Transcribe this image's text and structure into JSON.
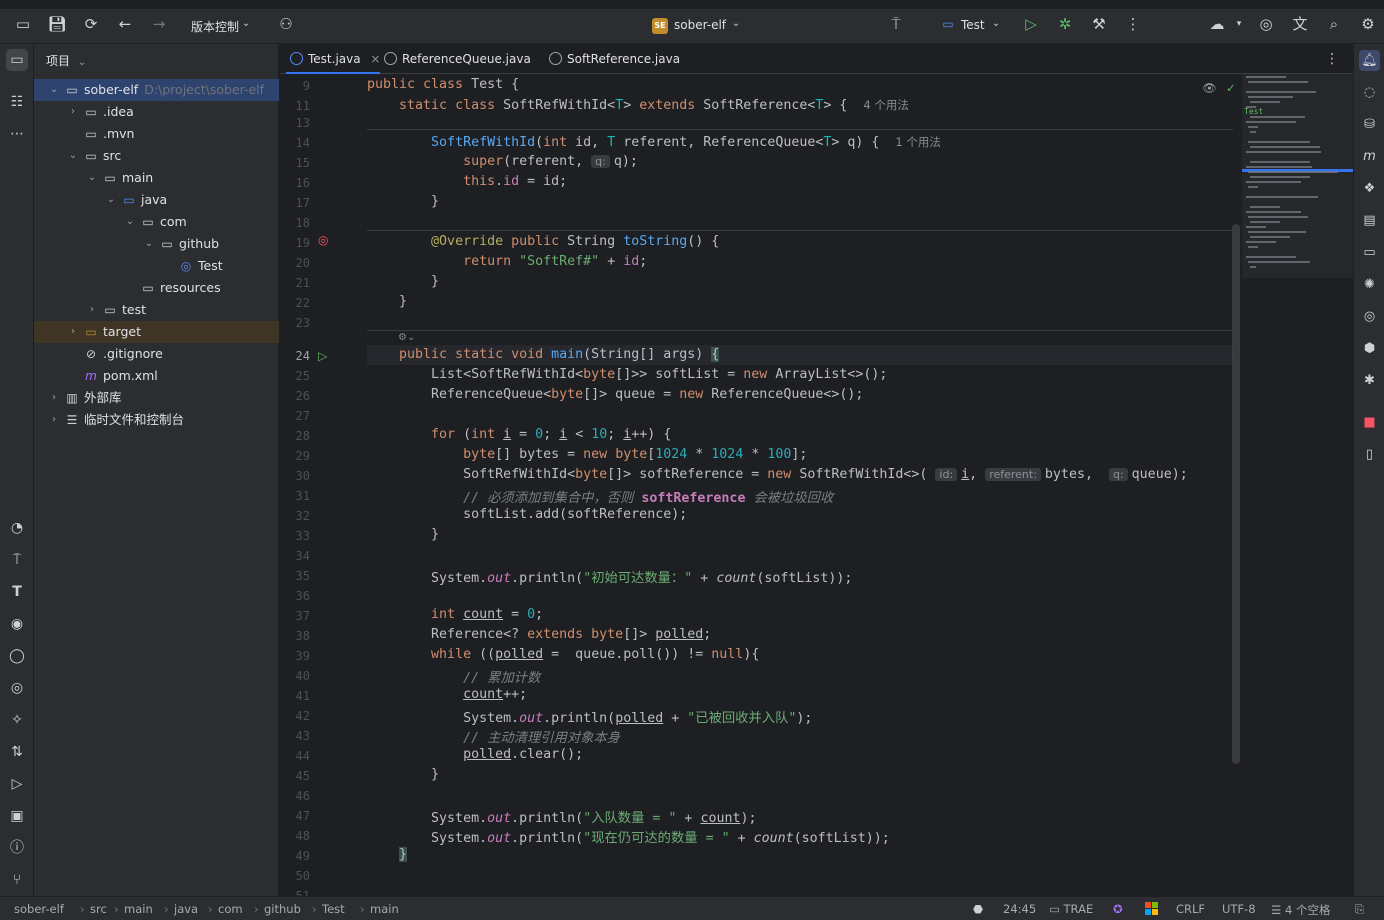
{
  "titlebar": {
    "vcs_label": "版本控制",
    "project_badge": "SE",
    "project_name": "sober-elf",
    "run_config": "Test"
  },
  "project_panel": {
    "header": "项目",
    "tree": [
      {
        "label": "sober-elf",
        "sub": "D:\\project\\sober-elf",
        "icon": "module-folder-icon",
        "indent": 0,
        "arrow": "⌄"
      },
      {
        "label": ".idea",
        "icon": "folder-icon",
        "indent": 1,
        "arrow": "›"
      },
      {
        "label": ".mvn",
        "icon": "folder-icon",
        "indent": 1,
        "arrow": ""
      },
      {
        "label": "src",
        "icon": "folder-icon",
        "indent": 1,
        "arrow": "⌄"
      },
      {
        "label": "main",
        "icon": "folder-icon",
        "indent": 2,
        "arrow": "⌄"
      },
      {
        "label": "java",
        "icon": "source-folder-icon",
        "indent": 3,
        "arrow": "⌄"
      },
      {
        "label": "com",
        "icon": "package-icon",
        "indent": 4,
        "arrow": "⌄"
      },
      {
        "label": "github",
        "icon": "package-icon",
        "indent": 5,
        "arrow": "⌄"
      },
      {
        "label": "Test",
        "icon": "java-class-icon",
        "indent": 6,
        "arrow": ""
      },
      {
        "label": "resources",
        "icon": "resources-folder-icon",
        "indent": 4,
        "arrow": ""
      },
      {
        "label": "test",
        "icon": "folder-icon",
        "indent": 2,
        "arrow": "›"
      },
      {
        "label": "target",
        "icon": "excluded-folder-icon",
        "indent": 1,
        "arrow": "›"
      },
      {
        "label": ".gitignore",
        "icon": "ignore-file-icon",
        "indent": 1,
        "arrow": ""
      },
      {
        "label": "pom.xml",
        "icon": "maven-icon",
        "indent": 1,
        "arrow": ""
      },
      {
        "label": "外部库",
        "icon": "library-icon",
        "indent": 0,
        "arrow": "›"
      },
      {
        "label": "临时文件和控制台",
        "icon": "scratches-icon",
        "indent": 0,
        "arrow": "›"
      }
    ]
  },
  "tabs": [
    {
      "label": "Test.java",
      "close": "×"
    },
    {
      "label": "ReferenceQueue.java",
      "close": ""
    },
    {
      "label": "SoftReference.java",
      "close": ""
    }
  ],
  "editor": {
    "line_numbers": [
      "9",
      "11",
      "13",
      "14",
      "15",
      "16",
      "17",
      "18",
      "19",
      "20",
      "21",
      "22",
      "23",
      "24",
      "25",
      "26",
      "27",
      "28",
      "29",
      "30",
      "31",
      "32",
      "33",
      "34",
      "35",
      "36",
      "37",
      "38",
      "39",
      "40",
      "41",
      "42",
      "43",
      "44",
      "45",
      "46",
      "47",
      "48",
      "49",
      "50",
      "51"
    ],
    "current_line": "24",
    "usage_hint_class": "4 个用法",
    "usage_hint_ctor": "1 个用法",
    "param_hints": {
      "q": "q:",
      "id": "id:",
      "referent": "referent:"
    },
    "strings": {
      "softref": "\"SoftRef#\"",
      "initial": "\"初始可达数量：\"",
      "polled_msg": "\"已被回收并入队\"",
      "queued": "\"入队数量 = \"",
      "still": "\"现在仍可达的数量 = \""
    },
    "comments": {
      "c1a": "// 必须添加到集合中，否则 ",
      "c1b": "softReference",
      "c1c": " 会被垃圾回收",
      "c2": "// 累加计数",
      "c3": "// 主动清理引用对象本身"
    },
    "numbers": {
      "zero": "0",
      "ten": "10",
      "k": "1024",
      "hundred": "100"
    }
  },
  "statusbar": {
    "breadcrumbs": [
      "sober-elf",
      "src",
      "main",
      "java",
      "com",
      "github",
      "Test",
      "main"
    ],
    "position": "24:45",
    "trae": "TRAE",
    "line_sep": "CRLF",
    "encoding": "UTF-8",
    "indent": "4 个空格"
  },
  "minimap_label": "Test"
}
